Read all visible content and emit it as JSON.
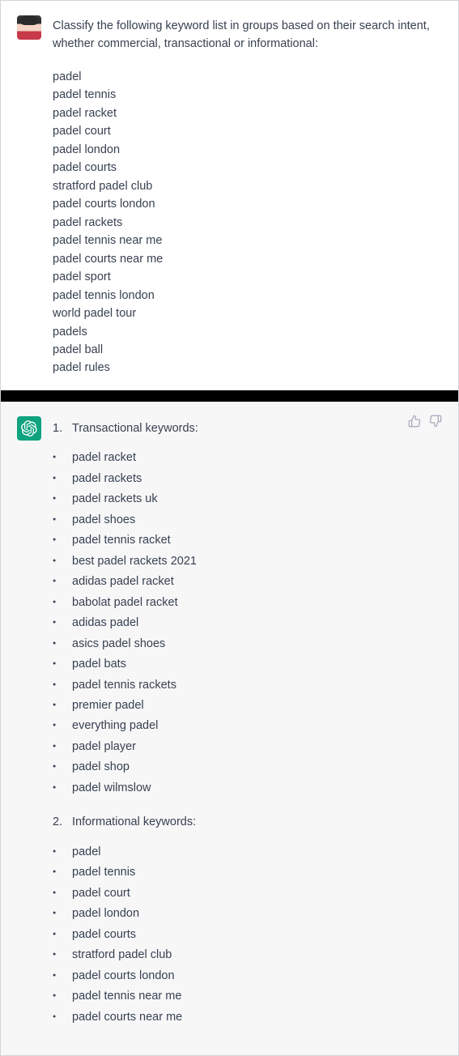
{
  "user": {
    "prompt": "Classify the following keyword list in groups based on their search intent, whether commercial, transactional or informational:",
    "keywords": [
      "padel",
      "padel tennis",
      "padel racket",
      "padel court",
      "padel london",
      "padel courts",
      "stratford padel club",
      "padel courts london",
      "padel rackets",
      "padel tennis near me",
      "padel courts near me",
      "padel sport",
      "padel tennis london",
      "world padel tour",
      "padels",
      "padel ball",
      "padel rules"
    ]
  },
  "assistant": {
    "groups": [
      {
        "number": "1.",
        "title": "Transactional keywords:",
        "items": [
          "padel racket",
          "padel rackets",
          "padel rackets uk",
          "padel shoes",
          "padel tennis racket",
          "best padel rackets 2021",
          "adidas padel racket",
          "babolat padel racket",
          "adidas padel",
          "asics padel shoes",
          "padel bats",
          "padel tennis rackets",
          "premier padel",
          "everything padel",
          "padel player",
          "padel shop",
          "padel wilmslow"
        ]
      },
      {
        "number": "2.",
        "title": "Informational keywords:",
        "items": [
          "padel",
          "padel tennis",
          "padel court",
          "padel london",
          "padel courts",
          "stratford padel club",
          "padel courts london",
          "padel tennis near me",
          "padel courts near me"
        ]
      }
    ]
  }
}
